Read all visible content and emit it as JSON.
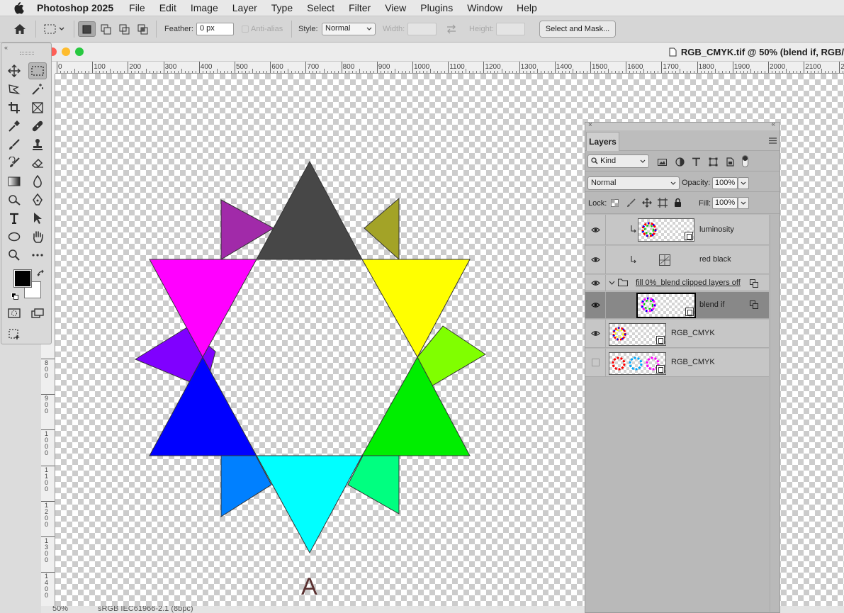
{
  "menubar": {
    "app_name": "Photoshop 2025",
    "items": [
      "File",
      "Edit",
      "Image",
      "Layer",
      "Type",
      "Select",
      "Filter",
      "View",
      "Plugins",
      "Window",
      "Help"
    ]
  },
  "options_bar": {
    "feather_label": "Feather:",
    "feather_value": "0 px",
    "anti_alias_label": "Anti-alias",
    "style_label": "Style:",
    "style_value": "Normal",
    "width_label": "Width:",
    "height_label": "Height:",
    "select_mask_label": "Select and Mask..."
  },
  "document": {
    "title": "RGB_CMYK.tif @ 50% (blend if, RGB/",
    "ruler_top": [
      "0",
      "100",
      "200",
      "300",
      "400",
      "500",
      "600",
      "700",
      "800",
      "900",
      "1000",
      "1100",
      "1200",
      "1300",
      "1400",
      "1500",
      "1600",
      "1700",
      "1800",
      "1900",
      "2000",
      "2100",
      "22"
    ],
    "ruler_left": [
      "8\n0\n0",
      "9\n0\n0",
      "1\n0\n0\n0",
      "1\n1\n0\n0",
      "1\n2\n0\n0",
      "1\n3\n0\n0",
      "1\n4\n0\n0"
    ],
    "canvas_letter": "A",
    "status_zoom": "50%",
    "status_profile": "sRGB IEC61966-2.1 (8bpc)"
  },
  "star_colors": {
    "top": "#474747",
    "top_left": "#a12aa9",
    "top_right": "#a3a327",
    "upper_left": "#ff00ff",
    "upper_right": "#ffff00",
    "left": "#8000ff",
    "right": "#80ff00",
    "lower_left": "#0000ff",
    "lower_right": "#00ee00",
    "bottom_left": "#0080ff",
    "bottom_right": "#00ff80",
    "bottom": "#00ffff"
  },
  "layers_panel": {
    "tab_label": "Layers",
    "kind_label": "Kind",
    "blend_mode": "Normal",
    "opacity_label": "Opacity:",
    "opacity_value": "100%",
    "lock_label": "Lock:",
    "fill_label": "Fill:",
    "fill_value": "100%",
    "layers": [
      {
        "name": "luminosity",
        "visible": true
      },
      {
        "name": "red black",
        "visible": true
      },
      {
        "name": "fill 0%_blend clipped layers off",
        "visible": true
      },
      {
        "name": "blend if",
        "visible": true,
        "selected": true
      },
      {
        "name": "RGB_CMYK",
        "visible": true
      },
      {
        "name": "RGB_CMYK",
        "visible": false
      }
    ]
  }
}
